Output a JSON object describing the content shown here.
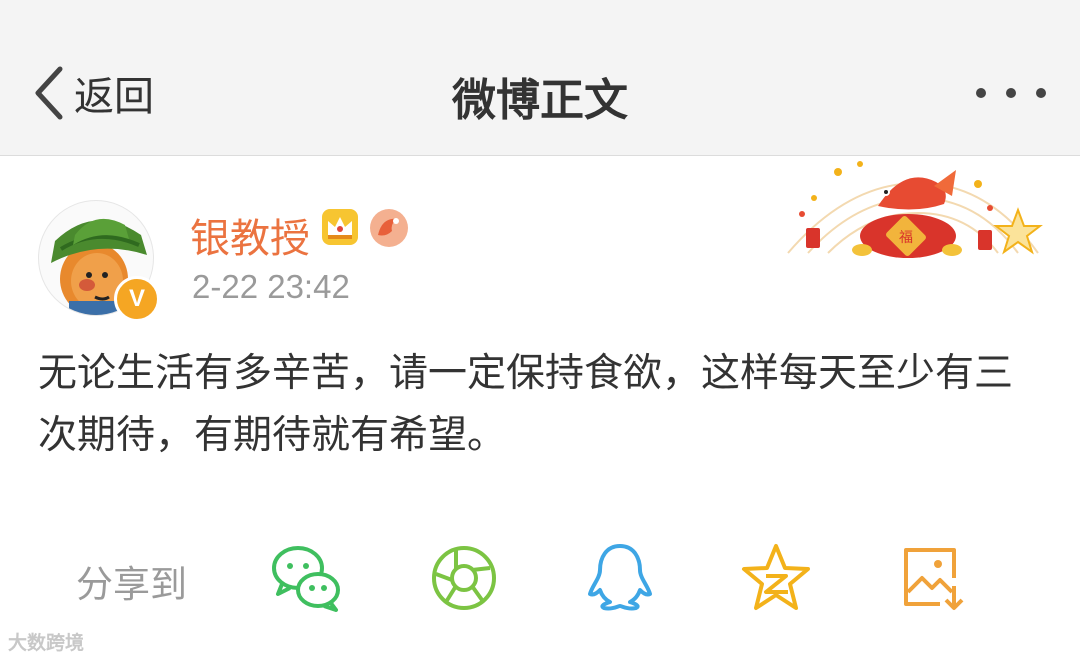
{
  "navbar": {
    "back_label": "返回",
    "title": "微博正文",
    "more_icon": "more-dots-icon"
  },
  "post": {
    "author": {
      "name": "银教授",
      "verified_badge": "V",
      "badges": [
        "crown-icon",
        "fan-icon"
      ]
    },
    "timestamp": "2-22 23:42",
    "text": "无论生活有多辛苦，请一定保持食欲，这样每天至少有三次期待，有期待就有希望。",
    "decoration": "new-year-koi-fish-banner"
  },
  "share": {
    "label": "分享到",
    "targets": [
      {
        "name": "wechat",
        "icon": "wechat-icon",
        "color": "#3fbf5f"
      },
      {
        "name": "moments",
        "icon": "moments-icon",
        "color": "#7cc443"
      },
      {
        "name": "qq",
        "icon": "qq-icon",
        "color": "#3ea6e5"
      },
      {
        "name": "qzone",
        "icon": "qzone-icon",
        "color": "#f3b21a"
      },
      {
        "name": "save-image",
        "icon": "save-image-icon",
        "color": "#f0a23a"
      }
    ]
  },
  "watermark": "大数跨境",
  "colors": {
    "accent": "#eb7340",
    "text": "#333333",
    "muted": "#9a9a9a",
    "navbar_bg": "#f4f4f4"
  }
}
